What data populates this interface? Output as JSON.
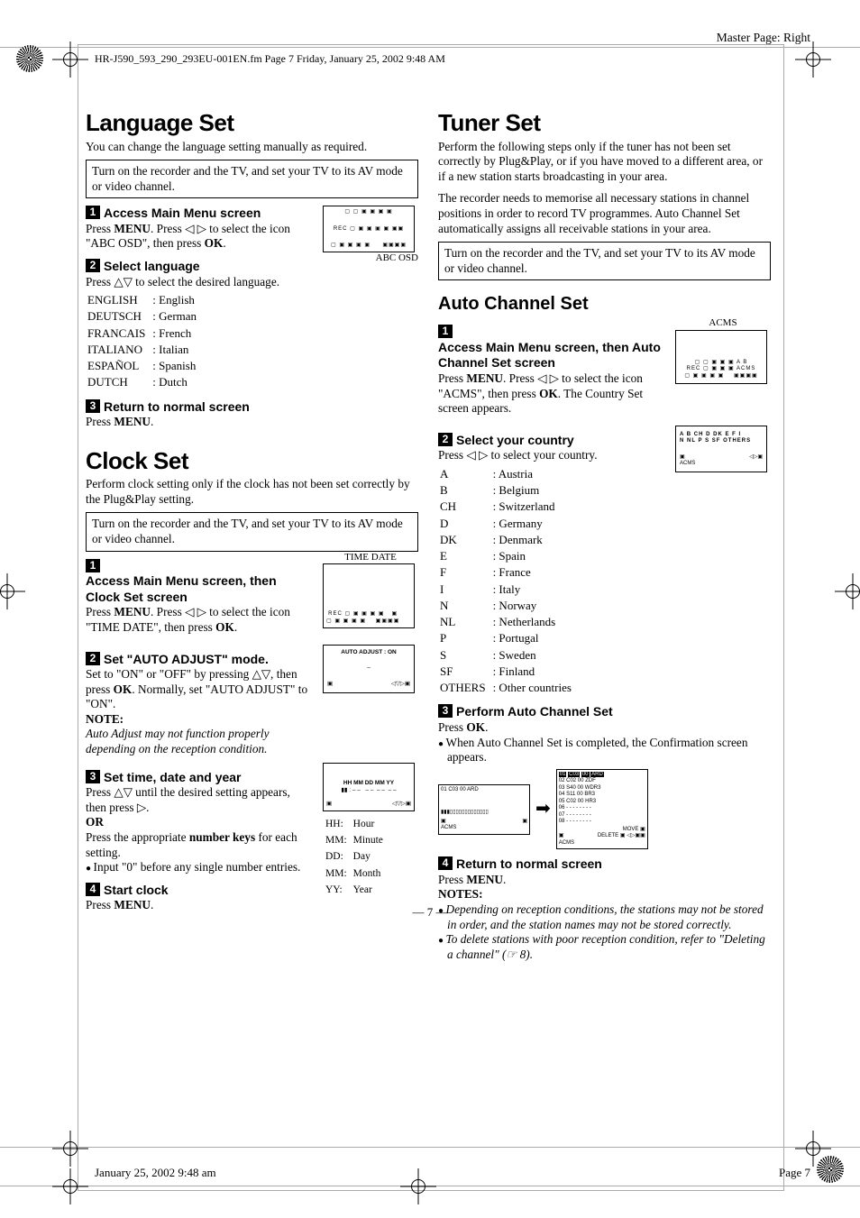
{
  "master": "Master Page: Right",
  "fm": "HR-J590_593_290_293EU-001EN.fm  Page 7  Friday, January 25, 2002  9:48 AM",
  "page_number": "— 7 —",
  "footer_date": "January 25, 2002 9:48 am",
  "footer_page": "Page 7",
  "lang": {
    "title": "Language Set",
    "intro": "You can change the language setting manually as required.",
    "box": "Turn on the recorder and the TV, and set your TV to its AV mode or video channel.",
    "s1_title": "Access Main Menu screen",
    "s1_body_a": "Press ",
    "s1_body_b": ". Press ◁ ▷ to select the icon \"ABC OSD\", then press ",
    "menu": "MENU",
    "ok": "OK",
    "s2_title": "Select language",
    "s2_body": "Press △▽ to select the desired language.",
    "languages": [
      [
        "ENGLISH",
        ": English"
      ],
      [
        "DEUTSCH",
        ": German"
      ],
      [
        "FRANCAIS",
        ": French"
      ],
      [
        "ITALIANO",
        ": Italian"
      ],
      [
        "ESPAÑOL",
        ": Spanish"
      ],
      [
        "DUTCH",
        ": Dutch"
      ]
    ],
    "fig_caption": "ABC OSD",
    "s3_title": "Return to normal screen",
    "s3_body": "Press "
  },
  "clock": {
    "title": "Clock Set",
    "intro": "Perform clock setting only if the clock has not been set correctly by the Plug&Play setting.",
    "box": "Turn on the recorder and the TV, and set your TV to its AV mode or video channel.",
    "s1_title": "Access Main Menu screen, then Clock Set screen",
    "s1_body_a": "Press ",
    "s1_body_b": ". Press ◁ ▷ to select the icon \"TIME DATE\", then press ",
    "fig1_label": "TIME DATE",
    "s2_title": "Set \"AUTO ADJUST\" mode.",
    "s2_body": "Set to \"ON\" or \"OFF\" by pressing △▽, then press ",
    "s2_body2": ". Normally, set \"AUTO ADJUST\" to \"ON\".",
    "fig2_text": "AUTO ADJUST : ON",
    "note_label": "NOTE:",
    "note": "Auto Adjust may not function properly depending on the reception condition.",
    "s3_title": "Set time, date and year",
    "s3_body1": "Press △▽ until the desired setting appears, then press ▷.",
    "or": "OR",
    "s3_body2_a": "Press the appropriate ",
    "s3_body2_b": "number keys",
    "s3_body2_c": " for each setting.",
    "s3_bullet": "Input \"0\" before any single number entries.",
    "fig3_label": "HH  MM  DD  MM  YY",
    "legend": [
      [
        "HH:",
        "Hour"
      ],
      [
        "MM:",
        "Minute"
      ],
      [
        "DD:",
        "Day"
      ],
      [
        "MM:",
        "Month"
      ],
      [
        "YY:",
        "Year"
      ]
    ],
    "s4_title": "Start clock",
    "s4_body": "Press "
  },
  "tuner": {
    "title": "Tuner Set",
    "intro1": "Perform the following steps only if the tuner has not been set correctly by Plug&Play, or if you have moved to a different area, or if a new station starts broadcasting in your area.",
    "intro2": "The recorder needs to memorise all necessary stations in channel positions in order to record TV programmes. Auto Channel Set automatically assigns all receivable stations in your area.",
    "box": "Turn on the recorder and the TV, and set your TV to its AV mode or video channel.",
    "acs_title": "Auto Channel Set",
    "s1_title": "Access Main Menu screen, then Auto Channel Set screen",
    "s1_body_a": "Press ",
    "s1_body_b": ". Press ◁ ▷ to select the icon \"ACMS\", then press ",
    "s1_body_c": ". The Country Set screen appears.",
    "fig1_label": "ACMS",
    "s2_title": "Select your country",
    "s2_body": "Press ◁ ▷ to select your country.",
    "countries": [
      [
        "A",
        ": Austria"
      ],
      [
        "B",
        ": Belgium"
      ],
      [
        "CH",
        ": Switzerland"
      ],
      [
        "D",
        ": Germany"
      ],
      [
        "DK",
        ": Denmark"
      ],
      [
        "E",
        ": Spain"
      ],
      [
        "F",
        ": France"
      ],
      [
        "I",
        ": Italy"
      ],
      [
        "N",
        ": Norway"
      ],
      [
        "NL",
        ": Netherlands"
      ],
      [
        "P",
        ": Portugal"
      ],
      [
        "S",
        ": Sweden"
      ],
      [
        "SF",
        ": Finland"
      ],
      [
        "OTHERS",
        ": Other countries"
      ]
    ],
    "country_text1": "A   B   CH  D  DK  E  F   I",
    "country_text2": "N  NL  P   S  SF   OTHERS",
    "s3_title": "Perform Auto Channel Set",
    "s3_body": "Press ",
    "s3_bullet": "When Auto Channel Set is completed, the Confirmation screen appears.",
    "pf1": [
      [
        "01",
        "C03",
        "00",
        "ARD"
      ]
    ],
    "pf2": [
      [
        "01",
        "C03",
        "00",
        "ARD"
      ],
      [
        "02",
        "C02",
        "00",
        "ZDF"
      ],
      [
        "03",
        "S40",
        "00",
        "WDR3"
      ],
      [
        "04",
        "S11",
        "00",
        "BR3"
      ],
      [
        "05",
        "C02",
        "00",
        "HR3"
      ],
      [
        "06",
        "- -",
        "- -",
        "- - - -"
      ],
      [
        "07",
        "- -",
        "- -",
        "- - - -"
      ],
      [
        "08",
        "- -",
        "- -",
        "- - - -"
      ]
    ],
    "pf2_move": "MOVE ▣",
    "pf2_delete": "DELETE ▣ ◁▷▣▣",
    "s4_title": "Return to normal screen",
    "s4_body": "Press ",
    "notes_label": "NOTES:",
    "note1": "Depending on reception conditions, the stations may not be stored in order, and the station names may not be stored correctly.",
    "note2": "To delete stations with poor reception condition, refer to \"Deleting a channel\" (☞ 8)."
  }
}
